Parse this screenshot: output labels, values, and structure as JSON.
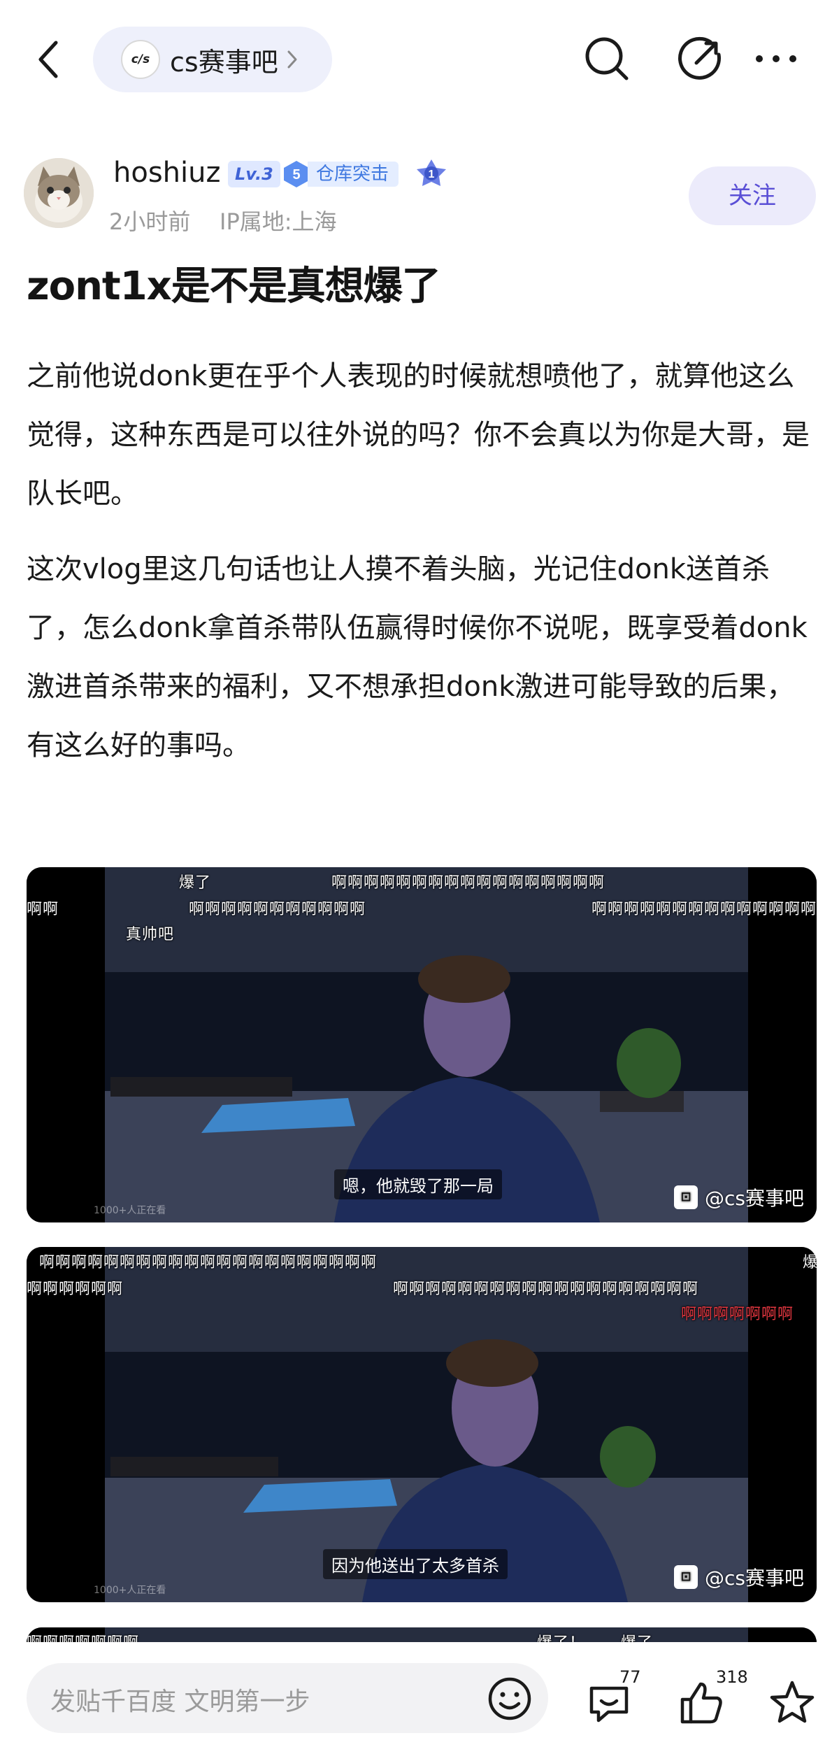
{
  "header": {
    "forum_logo_text": "c/s",
    "forum_name": "cs赛事吧"
  },
  "author": {
    "username": "hoshiuz",
    "level": "Lv.3",
    "badge_number": "5",
    "badge_title": "仓库突击",
    "medal_number": "1",
    "time": "2小时前",
    "ip": "IP属地:上海",
    "follow_label": "关注"
  },
  "post": {
    "title": "zont1x是不是真想爆了",
    "paragraphs": [
      "之前他说donk更在乎个人表现的时候就想喷他了，就算他这么觉得，这种东西是可以往外说的吗？你不会真以为你是大哥，是队长吧。",
      "这次vlog里这几句话也让人摸不着头脑，光记住donk送首杀了，怎么donk拿首杀带队伍赢得时候你不说呢，既享受着donk激进首杀带来的福利，又不想承担donk激进可能导致的后果，有这么好的事吗。"
    ]
  },
  "images": [
    {
      "subtitle": "嗯，他就毁了那一局",
      "watermark": "@cs赛事吧",
      "viewers": "1000+人正在看",
      "danmu": [
        "爆了",
        "啊啊啊啊啊啊啊啊啊啊啊啊啊啊啊啊啊",
        "啊啊",
        "啊啊啊啊啊啊啊啊啊啊啊",
        "啊啊啊啊啊啊啊啊啊啊啊啊啊啊啊",
        "真帅吧"
      ]
    },
    {
      "subtitle": "因为他送出了太多首杀",
      "watermark": "@cs赛事吧",
      "viewers": "1000+人正在看",
      "danmu": [
        "啊啊啊啊啊啊啊啊啊啊啊啊啊啊啊啊啊啊啊啊啊",
        "爆",
        "啊啊啊啊啊啊",
        "啊啊啊啊啊啊啊啊啊啊啊啊啊啊啊啊啊啊啊",
        "啊啊啊啊啊啊啊"
      ]
    },
    {
      "danmu": [
        "啊啊啊啊啊啊啊",
        "爆了！",
        "爆了"
      ]
    }
  ],
  "bottombar": {
    "comment_placeholder": "发贴千百度 文明第一步",
    "comment_count": "77",
    "like_count": "318"
  },
  "colors": {
    "accent": "#5a4fd6",
    "follow_bg": "#ecebfb",
    "pill_bg": "#eef0fb",
    "badge_blue": "#3f78e0",
    "danmu_red": "#e2363f"
  },
  "icons": [
    "back-arrow-icon",
    "chevron-right-icon",
    "search-icon",
    "share-icon",
    "more-icon",
    "emoji-icon",
    "comment-icon",
    "like-icon",
    "star-icon",
    "bilibili-icon"
  ]
}
